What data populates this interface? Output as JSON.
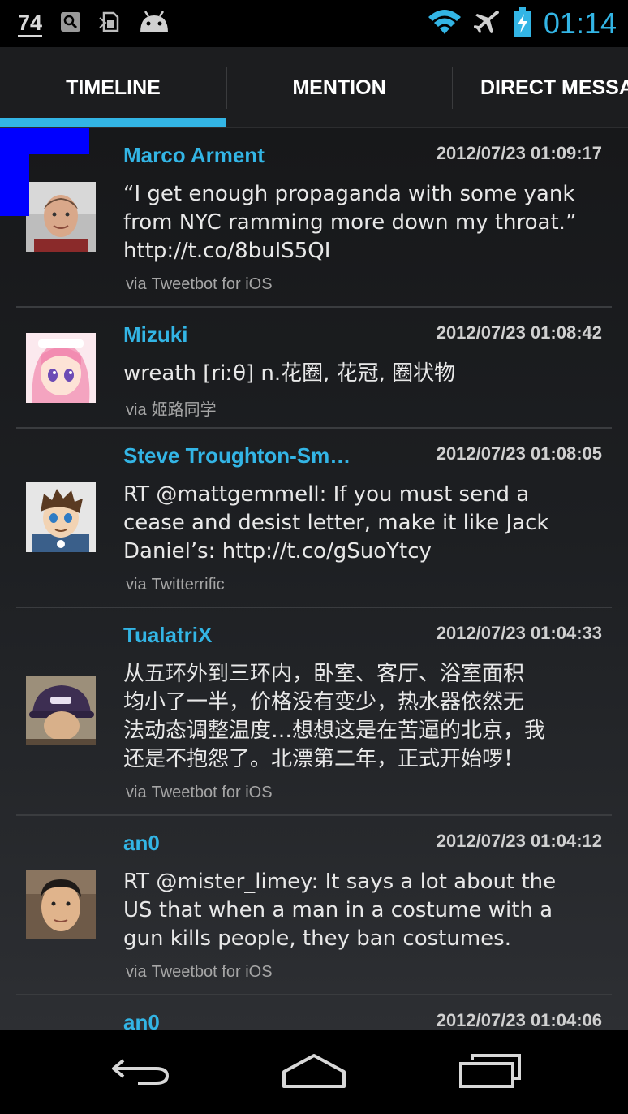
{
  "status_bar": {
    "notification_count": "74",
    "clock": "01:14",
    "clock_color": "#33b5e5",
    "icons": [
      "notification-count-icon",
      "search-icon",
      "sim-card-icon",
      "android-icon",
      "wifi-icon",
      "airplane-mode-icon",
      "battery-charging-icon"
    ]
  },
  "tabs": [
    {
      "label": "TIMELINE",
      "selected": true
    },
    {
      "label": "MENTION",
      "selected": false
    },
    {
      "label": "DIRECT MESSAGES",
      "selected": false
    }
  ],
  "accent_color": "#33b5e5",
  "tweets": [
    {
      "user": "Marco Arment",
      "timestamp": "2012/07/23 01:09:17",
      "lines": [
        "“I get enough propaganda with some yank",
        "from NYC ramming more down my throat.”",
        "http://t.co/8buIS5QI"
      ],
      "via": "via",
      "source": "Tweetbot for iOS"
    },
    {
      "user": "Mizuki",
      "timestamp": "2012/07/23 01:08:42",
      "lines": [
        "wreath [riːθ] n.花圈, 花冠, 圈状物"
      ],
      "via": "via",
      "source": "姬路同学"
    },
    {
      "user": "Steve Troughton-Sm…",
      "timestamp": "2012/07/23 01:08:05",
      "lines": [
        "RT @mattgemmell: If you must send a",
        "cease and desist letter, make it like Jack",
        "Daniel’s: http://t.co/gSuoYtcy"
      ],
      "via": "via",
      "source": "Twitterrific"
    },
    {
      "user": "TualatriX",
      "timestamp": "2012/07/23 01:04:33",
      "lines": [
        "从五环外到三环内，卧室、客厅、浴室面积",
        "均小了一半，价格没有变少，热水器依然无",
        "法动态调整温度…想想这是在苦逼的北京，我",
        "还是不抱怨了。北漂第二年，正式开始啰！"
      ],
      "via": "via",
      "source": "Tweetbot for iOS"
    },
    {
      "user": "an0",
      "timestamp": "2012/07/23 01:04:12",
      "lines": [
        "RT @mister_limey: It says a lot about the",
        "US that when a man in a costume with a",
        "gun kills people, they ban costumes."
      ],
      "via": "via",
      "source": "Tweetbot for iOS"
    },
    {
      "user": "an0",
      "timestamp": "2012/07/23 01:04:06"
    }
  ],
  "nav_bar": {
    "buttons": [
      "back-icon",
      "home-icon",
      "recent-apps-icon"
    ]
  }
}
